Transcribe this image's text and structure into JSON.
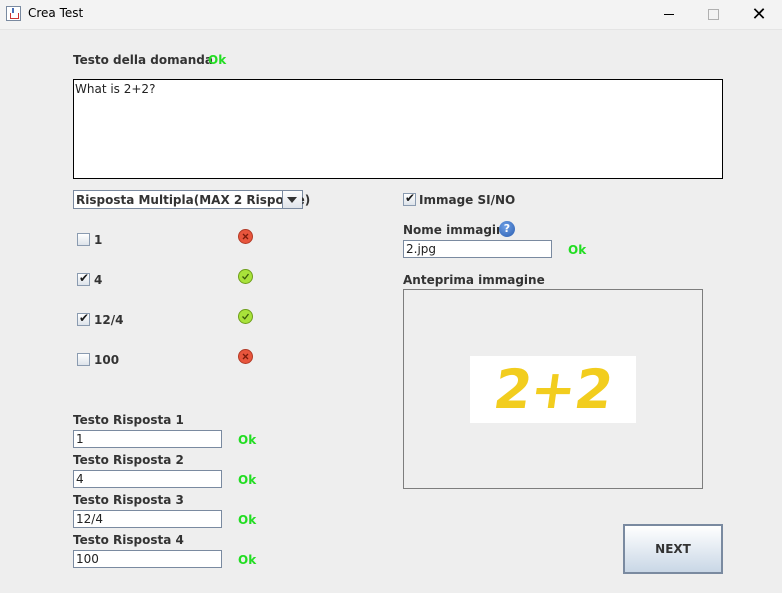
{
  "window": {
    "title": "Crea Test"
  },
  "question": {
    "label": "Testo della domanda",
    "status": "Ok",
    "text": "What is 2+2?"
  },
  "answer_type": {
    "selected": "Risposta Multipla(MAX 2 Risposte)"
  },
  "answers": [
    {
      "label": "1",
      "checked": false,
      "correct": false
    },
    {
      "label": "4",
      "checked": true,
      "correct": true
    },
    {
      "label": "12/4",
      "checked": true,
      "correct": true
    },
    {
      "label": "100",
      "checked": false,
      "correct": false
    }
  ],
  "answer_fields": [
    {
      "label": "Testo Risposta 1",
      "value": "1",
      "status": "Ok"
    },
    {
      "label": "Testo Risposta 2",
      "value": "4",
      "status": "Ok"
    },
    {
      "label": "Testo Risposta 3",
      "value": "12/4",
      "status": "Ok"
    },
    {
      "label": "Testo Risposta 4",
      "value": "100",
      "status": "Ok"
    }
  ],
  "image": {
    "toggle_label": "Immage SI/NO",
    "toggle_checked": true,
    "name_label": "Nome immagine",
    "name_value": "2.jpg",
    "name_status": "Ok",
    "preview_label": "Anteprima immagine",
    "preview_text": "2+2"
  },
  "buttons": {
    "next": "NEXT"
  },
  "colors": {
    "ok": "#22dd22",
    "wrong": "#e8553c",
    "right": "#a8e23a"
  }
}
